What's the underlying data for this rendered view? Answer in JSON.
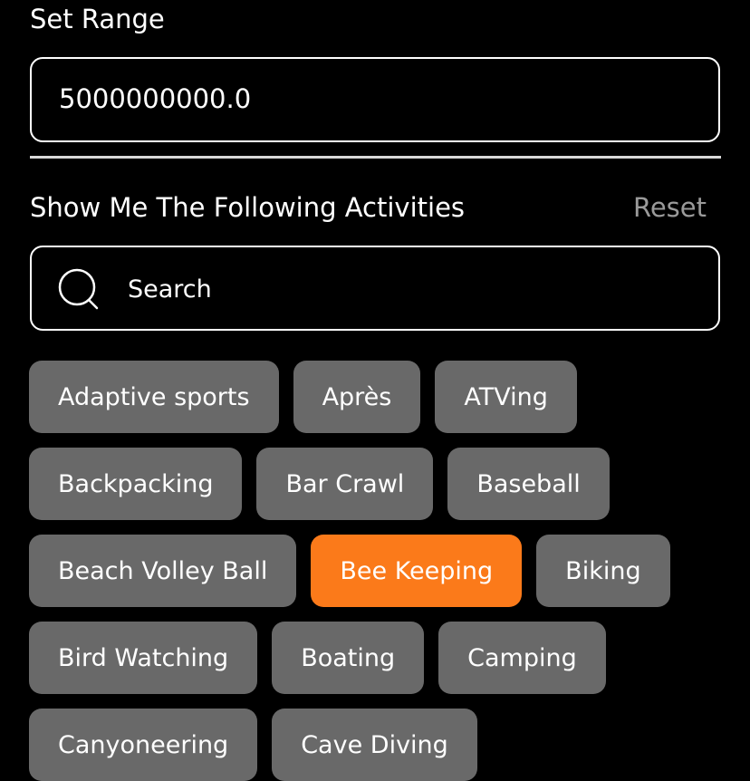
{
  "range": {
    "label": "Set Range",
    "value": "5000000000.0"
  },
  "activities": {
    "title": "Show Me The Following Activities",
    "reset_label": "Reset",
    "search_placeholder": "Search",
    "chips": [
      {
        "label": "Adaptive sports",
        "selected": false
      },
      {
        "label": "Après",
        "selected": false
      },
      {
        "label": "ATVing",
        "selected": false
      },
      {
        "label": "Backpacking",
        "selected": false
      },
      {
        "label": "Bar Crawl",
        "selected": false
      },
      {
        "label": "Baseball",
        "selected": false
      },
      {
        "label": "Beach Volley Ball",
        "selected": false
      },
      {
        "label": "Bee Keeping",
        "selected": true
      },
      {
        "label": "Biking",
        "selected": false
      },
      {
        "label": "Bird Watching",
        "selected": false
      },
      {
        "label": "Boating",
        "selected": false
      },
      {
        "label": "Camping",
        "selected": false
      },
      {
        "label": "Canyoneering",
        "selected": false
      },
      {
        "label": "Cave Diving",
        "selected": false
      }
    ]
  },
  "colors": {
    "background": "#000000",
    "chip": "#696969",
    "chip_selected": "#fb7a1a",
    "reset": "#9a9a9a"
  },
  "icons": {
    "search": "search-icon"
  }
}
